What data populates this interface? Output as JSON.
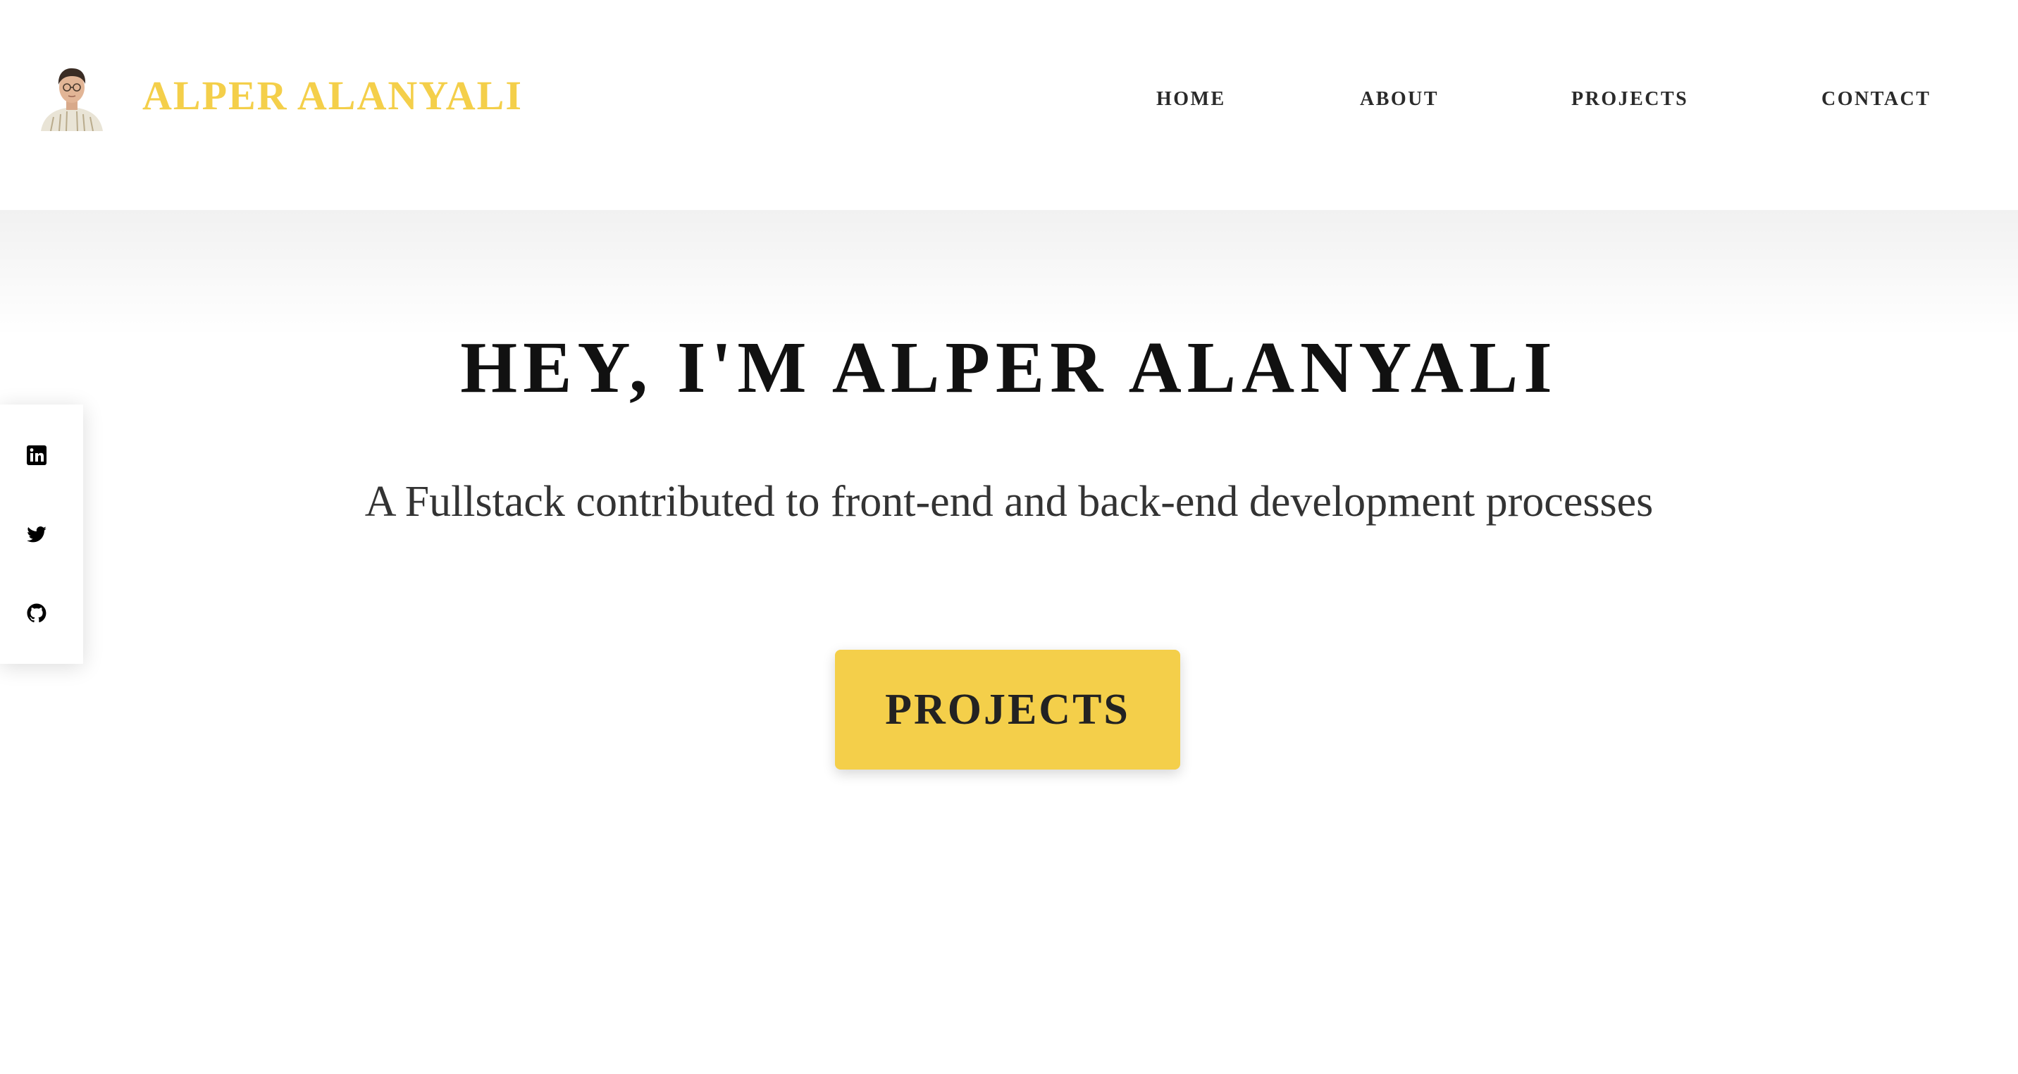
{
  "header": {
    "brand_name": "ALPER ALANYALI",
    "nav": {
      "home": "HOME",
      "about": "ABOUT",
      "projects": "PROJECTS",
      "contact": "CONTACT"
    }
  },
  "social": {
    "items": [
      {
        "icon": "linkedin-icon"
      },
      {
        "icon": "twitter-icon"
      },
      {
        "icon": "github-icon"
      }
    ]
  },
  "hero": {
    "title": "HEY, I'M ALPER ALANYALI",
    "subtitle": "A Fullstack contributed to front-end and back-end development processes",
    "cta_label": "PROJECTS"
  },
  "colors": {
    "accent": "#f4cf4a",
    "text_dark": "#111111",
    "text_body": "#333333",
    "background": "#ffffff"
  }
}
